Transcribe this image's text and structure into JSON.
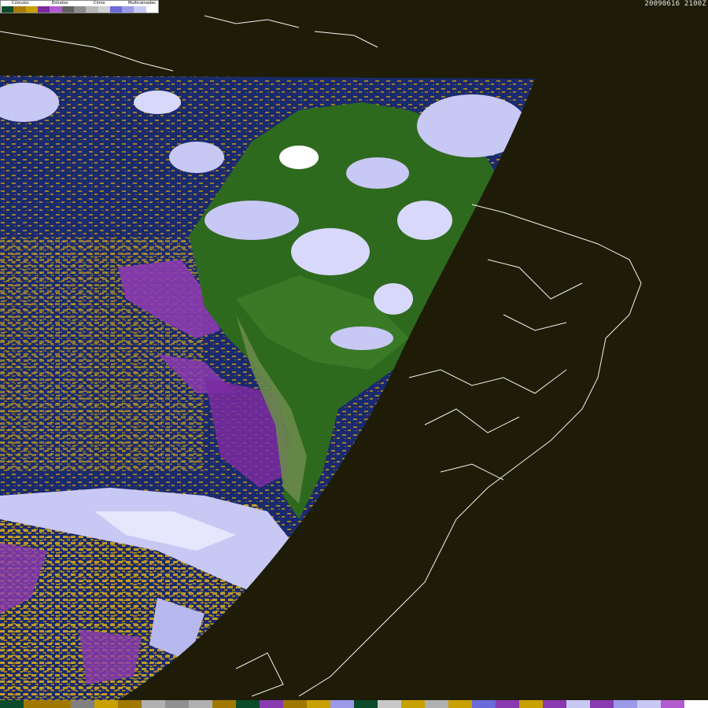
{
  "timestamp": "20090616 2100Z",
  "legend": {
    "labels": {
      "cumulos": "Cúmulos",
      "estratos": "Estratos",
      "cirros": "Cirros",
      "multicamadas": "Multicamadas"
    },
    "colors": [
      "#0b4a2a",
      "#a87c00",
      "#c8a000",
      "#7a2a9a",
      "#b25ad0",
      "#606060",
      "#8c8c8c",
      "#b8b8b8",
      "#d0d0d0",
      "#6a6ad8",
      "#9a9ae8",
      "#c8c8f4",
      "#ffffff"
    ]
  },
  "bottom_palette": [
    "#0b4a2a",
    "#a07800",
    "#a07800",
    "#808080",
    "#c8a000",
    "#a07800",
    "#b0b0b0",
    "#909090",
    "#b0b0b0",
    "#a07800",
    "#0b4a2a",
    "#8a3ab0",
    "#a07800",
    "#c8a000",
    "#9a9ae8",
    "#0b4a2a",
    "#c8c8c8",
    "#c8a000",
    "#b0b0b0",
    "#c8a000",
    "#6a6ad8",
    "#8a3ab0",
    "#c8a000",
    "#8a3ab0",
    "#c8c8f4",
    "#8a3ab0",
    "#9a9ae8",
    "#c8c8f4",
    "#b25ad0",
    "#ffffff"
  ],
  "colors": {
    "background": "#1e1c06",
    "ocean": "#1a2a6e",
    "cumulus": "#c89a10",
    "stratus": "#8a3ab0",
    "cirrus": "#c8c8f4",
    "land": "#2e6a1e",
    "borders": "#ffffff"
  }
}
